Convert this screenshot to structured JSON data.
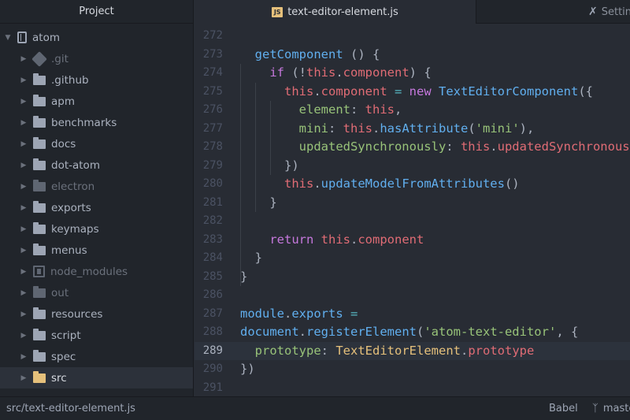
{
  "sidebar": {
    "title": "Project",
    "root": "atom",
    "items": [
      {
        "label": ".git",
        "kind": "git",
        "dim": true
      },
      {
        "label": ".github",
        "kind": "folder"
      },
      {
        "label": "apm",
        "kind": "folder"
      },
      {
        "label": "benchmarks",
        "kind": "folder"
      },
      {
        "label": "docs",
        "kind": "folder"
      },
      {
        "label": "dot-atom",
        "kind": "folder"
      },
      {
        "label": "electron",
        "kind": "folder",
        "dim": true
      },
      {
        "label": "exports",
        "kind": "folder"
      },
      {
        "label": "keymaps",
        "kind": "folder"
      },
      {
        "label": "menus",
        "kind": "folder"
      },
      {
        "label": "node_modules",
        "kind": "submodule",
        "dim": true
      },
      {
        "label": "out",
        "kind": "folder",
        "dim": true
      },
      {
        "label": "resources",
        "kind": "folder"
      },
      {
        "label": "script",
        "kind": "folder"
      },
      {
        "label": "spec",
        "kind": "folder"
      },
      {
        "label": "src",
        "kind": "folder",
        "selected": true
      }
    ]
  },
  "tabs": {
    "active": "text-editor-element.js",
    "active_badge": "JS",
    "settings": "Settings"
  },
  "editor": {
    "cursor_line": 289,
    "lines": [
      {
        "n": "272",
        "tokens": []
      },
      {
        "n": "273",
        "tokens": [
          [
            "  ",
            ""
          ],
          [
            "getComponent",
            "f"
          ],
          [
            " () {",
            ""
          ]
        ]
      },
      {
        "n": "274",
        "tokens": [
          [
            "    ",
            ""
          ],
          [
            "if",
            "k"
          ],
          [
            " (!",
            ""
          ],
          [
            "this",
            "t"
          ],
          [
            ".",
            ""
          ],
          [
            "component",
            "t"
          ],
          [
            ") {",
            ""
          ]
        ]
      },
      {
        "n": "275",
        "tokens": [
          [
            "      ",
            ""
          ],
          [
            "this",
            "t"
          ],
          [
            ".",
            ""
          ],
          [
            "component",
            "t"
          ],
          [
            " = ",
            "o"
          ],
          [
            "new",
            "k"
          ],
          [
            " ",
            ""
          ],
          [
            "TextEditorComponent",
            "f"
          ],
          [
            "({",
            ""
          ]
        ]
      },
      {
        "n": "276",
        "tokens": [
          [
            "        ",
            ""
          ],
          [
            "element",
            "a"
          ],
          [
            ": ",
            ""
          ],
          [
            "this",
            "t"
          ],
          [
            ",",
            ""
          ]
        ]
      },
      {
        "n": "277",
        "tokens": [
          [
            "        ",
            ""
          ],
          [
            "mini",
            "a"
          ],
          [
            ": ",
            ""
          ],
          [
            "this",
            "t"
          ],
          [
            ".",
            ""
          ],
          [
            "hasAttribute",
            "f"
          ],
          [
            "(",
            ""
          ],
          [
            "'mini'",
            "s"
          ],
          [
            "),",
            ""
          ]
        ]
      },
      {
        "n": "278",
        "tokens": [
          [
            "        ",
            ""
          ],
          [
            "updatedSynchronously",
            "a"
          ],
          [
            ": ",
            ""
          ],
          [
            "this",
            "t"
          ],
          [
            ".",
            ""
          ],
          [
            "updatedSynchronously",
            "t"
          ]
        ]
      },
      {
        "n": "279",
        "tokens": [
          [
            "      ",
            ""
          ],
          [
            "})",
            ""
          ]
        ]
      },
      {
        "n": "280",
        "tokens": [
          [
            "      ",
            ""
          ],
          [
            "this",
            "t"
          ],
          [
            ".",
            ""
          ],
          [
            "updateModelFromAttributes",
            "f"
          ],
          [
            "()",
            ""
          ]
        ]
      },
      {
        "n": "281",
        "tokens": [
          [
            "    ",
            ""
          ],
          [
            "}",
            ""
          ]
        ]
      },
      {
        "n": "282",
        "tokens": []
      },
      {
        "n": "283",
        "tokens": [
          [
            "    ",
            ""
          ],
          [
            "return",
            "k"
          ],
          [
            " ",
            ""
          ],
          [
            "this",
            "t"
          ],
          [
            ".",
            ""
          ],
          [
            "component",
            "t"
          ]
        ]
      },
      {
        "n": "284",
        "tokens": [
          [
            "  ",
            ""
          ],
          [
            "}",
            ""
          ]
        ]
      },
      {
        "n": "285",
        "tokens": [
          [
            "}",
            ""
          ]
        ]
      },
      {
        "n": "286",
        "tokens": []
      },
      {
        "n": "287",
        "tokens": [
          [
            "module",
            "f"
          ],
          [
            ".",
            ""
          ],
          [
            "exports",
            "f"
          ],
          [
            " =",
            "o"
          ]
        ]
      },
      {
        "n": "288",
        "tokens": [
          [
            "document",
            "f"
          ],
          [
            ".",
            ""
          ],
          [
            "registerElement",
            "f"
          ],
          [
            "(",
            ""
          ],
          [
            "'atom-text-editor'",
            "s"
          ],
          [
            ", {",
            ""
          ]
        ]
      },
      {
        "n": "289",
        "tokens": [
          [
            "  ",
            ""
          ],
          [
            "prototype",
            "a"
          ],
          [
            ": ",
            ""
          ],
          [
            "TextEditorElement",
            "c"
          ],
          [
            ".",
            ""
          ],
          [
            "prototype",
            "t"
          ]
        ]
      },
      {
        "n": "290",
        "tokens": [
          [
            "})",
            ""
          ]
        ]
      },
      {
        "n": "291",
        "tokens": []
      }
    ]
  },
  "status": {
    "path": "src/text-editor-element.js",
    "grammar": "Babel",
    "branch": "master"
  }
}
